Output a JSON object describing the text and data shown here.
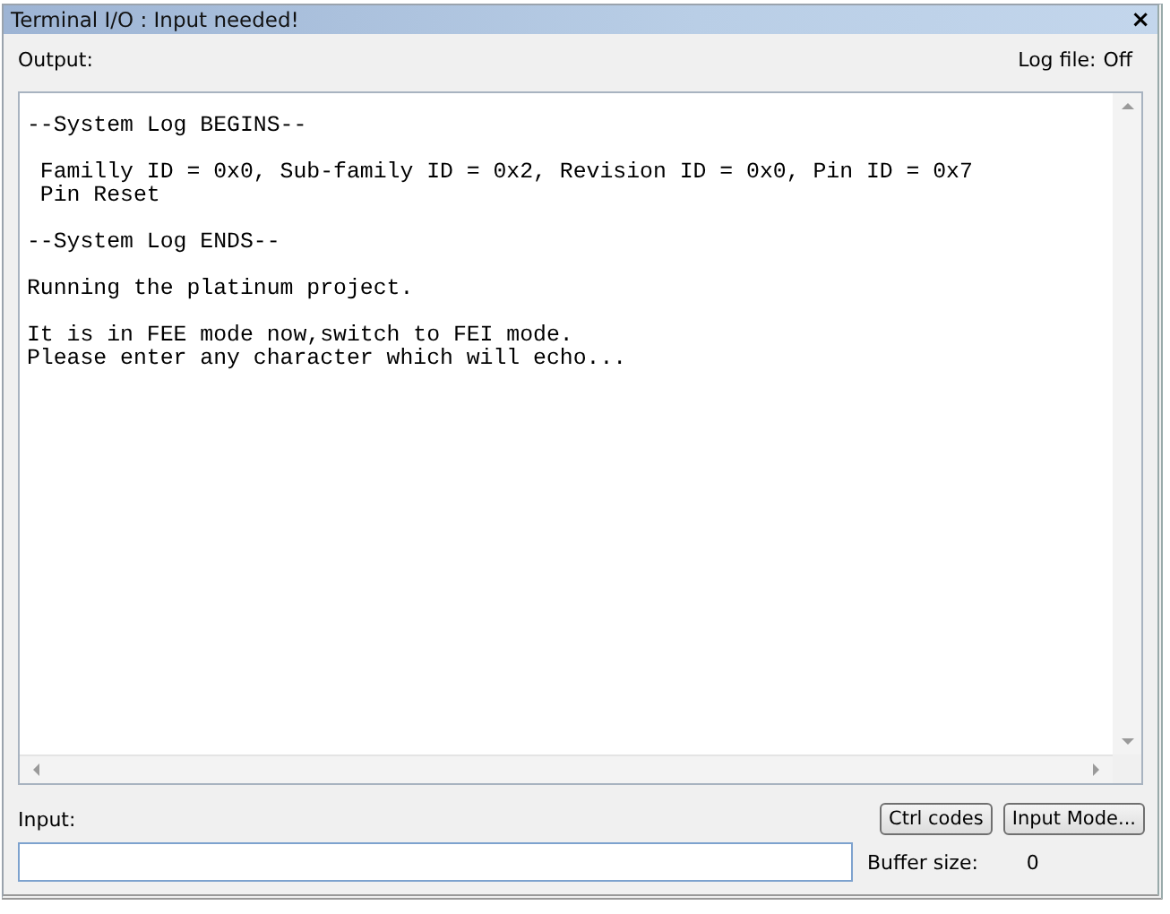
{
  "window": {
    "title": "Terminal I/O : Input needed!",
    "close": "×"
  },
  "output_label": "Output:",
  "log_file": {
    "label": "Log file:",
    "value": "Off"
  },
  "output_paragraphs": [
    [
      "--System Log BEGINS--"
    ],
    [
      " Familly ID = 0x0, Sub-family ID = 0x2, Revision ID = 0x0, Pin ID = 0x7",
      " Pin Reset"
    ],
    [
      "--System Log ENDS--"
    ],
    [
      "Running the platinum project."
    ],
    [
      "It is in FEE mode now,switch to FEI mode.",
      "Please enter any character which will echo..."
    ]
  ],
  "input_label": "Input:",
  "buttons": [
    "Ctrl codes",
    "Input Mode..."
  ],
  "buffer_size": {
    "label": "Buffer size:",
    "value": "0"
  }
}
